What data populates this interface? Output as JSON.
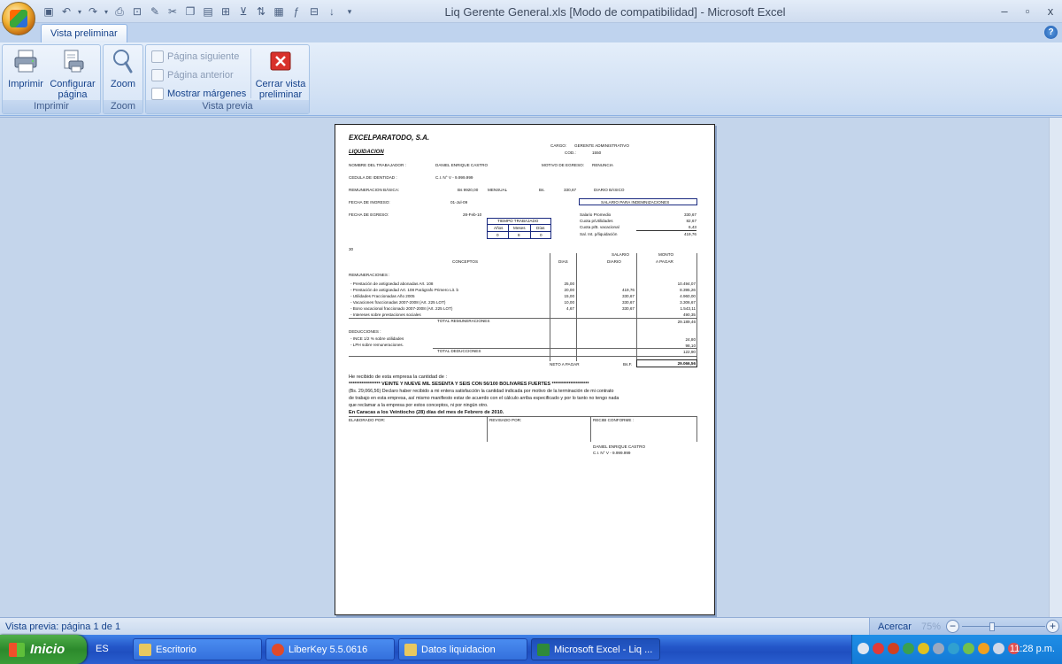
{
  "window": {
    "title": "Liq  Gerente General.xls  [Modo de compatibilidad] - Microsoft Excel",
    "controls": [
      "–",
      "▫",
      "x"
    ]
  },
  "qat_icons": [
    "save-icon",
    "undo-icon",
    "redo-icon",
    "print-icon",
    "preview-icon",
    "spell-icon",
    "cut-icon",
    "copy-icon",
    "paste-icon",
    "format-icon",
    "filter-icon",
    "sort-icon",
    "chart-icon",
    "function-icon",
    "table-icon",
    "sort-asc-icon",
    "customize-icon"
  ],
  "ribbon": {
    "tab": "Vista preliminar",
    "groups": {
      "imprimir": {
        "label": "Imprimir",
        "print_label": "Imprimir",
        "setup_label_1": "Configurar",
        "setup_label_2": "página"
      },
      "zoom": {
        "label": "Zoom",
        "zoom_label": "Zoom"
      },
      "preview": {
        "label": "Vista previa",
        "next_page": "Página siguiente",
        "prev_page": "Página anterior",
        "show_margins": "Mostrar márgenes",
        "close_label_1": "Cerrar vista",
        "close_label_2": "preliminar"
      }
    }
  },
  "document": {
    "company": "EXCELPARATODO, S.A.",
    "title": "LIQUIDACION",
    "cargo_label": "CARGO:",
    "cargo_value": "GERENTE ADMINISTRATIVO",
    "cod_label": "COD.:",
    "cod_value": "1550",
    "worker_label": "NOMBRE DEL TRABAJADOR :",
    "worker_value": "DANIEL ENRIQUE CASTRO",
    "motivo_label": "MOTIVO DE EGRESO:",
    "motivo_value": "RENUNCIA",
    "cedula_label": "CEDULA DE IDENTIDAD :",
    "cedula_value": "C.I. N° V - 9.999.999",
    "remun_label": "REMUNERACION BÁSICA:",
    "remun_value": "Bs 9920,00",
    "remun_period": "MENSUAL",
    "bs_label": "Bs.",
    "daily_value": "330,67",
    "daily_label": "DIARIO BÁSICO",
    "ingreso_label": "FECHA DE INGRESO:",
    "ingreso_value": "01-Jul-09",
    "egreso_label": "FECHA DE EGRESO:",
    "egreso_value": "28-Feb-10",
    "salario_box": "SALARIO PARA INDEMNIZACIONES",
    "tiempo_title": "TIEMPO TRABAJADO",
    "tiempo_headers": [
      "Años",
      "Meses",
      "Días"
    ],
    "tiempo_values": [
      "0",
      "8",
      "0"
    ],
    "salary_lines": [
      {
        "label": "Salario Promedio",
        "value": "330,67"
      },
      {
        "label": "Cuota p/Utilidades",
        "value": "82,67"
      },
      {
        "label": "Cuota p/B. vacacional",
        "value": "6,43"
      },
      {
        "label": "Sal. Int. p/liquidación",
        "value": "419,76"
      }
    ],
    "short_code": "30",
    "col_conceptos": "CONCEPTOS",
    "col_dias": "DIAS",
    "col_salario_1": "SALARIO",
    "col_salario_2": "DIARIO",
    "col_monto_1": "MONTO",
    "col_monto_2": "A PAGAR",
    "remuneraciones_label": "REMUNERACIONES :",
    "rows": [
      {
        "concept": "- Prestación de antigüedad abonadas Art. 108",
        "dias": "25,00",
        "salario": "",
        "monto": "10.494,07"
      },
      {
        "concept": "- Prestación de antigüedad Art. 108 Parágrafo Primero Lit. b",
        "dias": "20,00",
        "salario": "419,76",
        "monto": "8.395,26"
      },
      {
        "concept": "- Utilidades Fraccionadas Año 2005",
        "dias": "15,00",
        "salario": "330,67",
        "monto": "4.960,00"
      },
      {
        "concept": "- Vacaciones fraccionadas 2007-2008 (Art. 225 LOT)",
        "dias": "10,00",
        "salario": "330,67",
        "monto": "3.306,67"
      },
      {
        "concept": "- Bono vacacional fraccionado 2007-2008 (Art. 225 LOT)",
        "dias": "4,67",
        "salario": "330,67",
        "monto": "1.543,11"
      },
      {
        "concept": "- Intereses sobre prestaciones sociales",
        "dias": "",
        "salario": "",
        "monto": "490,35"
      }
    ],
    "total_rem_label": "TOTAL REMUNERACIONES",
    "total_rem_value": "29.189,46",
    "deducciones_label": "DEDUCCIONES :",
    "deductions": [
      {
        "concept": "- INCE  1/2 % sobre utilidades",
        "monto": "24,80"
      },
      {
        "concept": "- LPH  sobre remuneraciones.",
        "monto": "98,10"
      }
    ],
    "total_ded_label": "TOTAL DEDUCCIONES",
    "total_ded_value": "122,90",
    "neto_label": "NETO A PAGAR",
    "neto_currency": "Bs.F.",
    "neto_value": "29.066,56",
    "received_line": "He recibido de esta empresa la cantidad de :",
    "amount_words": "***************** VEINTE Y NUEVE MIL SESENTA Y SEIS CON 56/100 BOLIVARES FUERTES ********************",
    "declaration_1": "(Bs. 29,066,56) Declaro haber recibido a mi entera satisfacción la cantidad indicada por motivo de la terminación de mi contrato",
    "declaration_2": "de trabajo en esta empresa, así mismo manifiesto estar de acuerdo con el cálculo arriba especificado y por lo tanto no tengo nada",
    "declaration_3": "que reclamar a la empresa por estos conceptos, ni por ningún otro.",
    "place_date": "En Caracas a los Veintiocho  (28) días del mes de Febrero de 2010.",
    "elaborado": "ELABORADO POR:",
    "revisado": "REVISADO POR:",
    "recibi": "RECIBI CONFORME :",
    "sign_name": "DANIEL ENRIQUE CASTRO",
    "sign_ci": "C.I. N° V - 9.999.999"
  },
  "status": {
    "left": "Vista previa: página 1 de 1",
    "zoom_label": "Acercar",
    "zoom_value": "75%",
    "zoom_level_percent": 75
  },
  "taskbar": {
    "start": "Inicio",
    "lang": "ES",
    "tasks": [
      "Escritorio",
      "LiberKey 5.5.0616",
      "Datos liquidacion",
      "Microsoft Excel - Liq ..."
    ],
    "clock": "11:28 p.m."
  },
  "colors": {
    "ribbon_text": "#15428b",
    "workspace": "#c4d5eb",
    "taskbar": "#2457c9",
    "close_red": "#d8312a"
  }
}
